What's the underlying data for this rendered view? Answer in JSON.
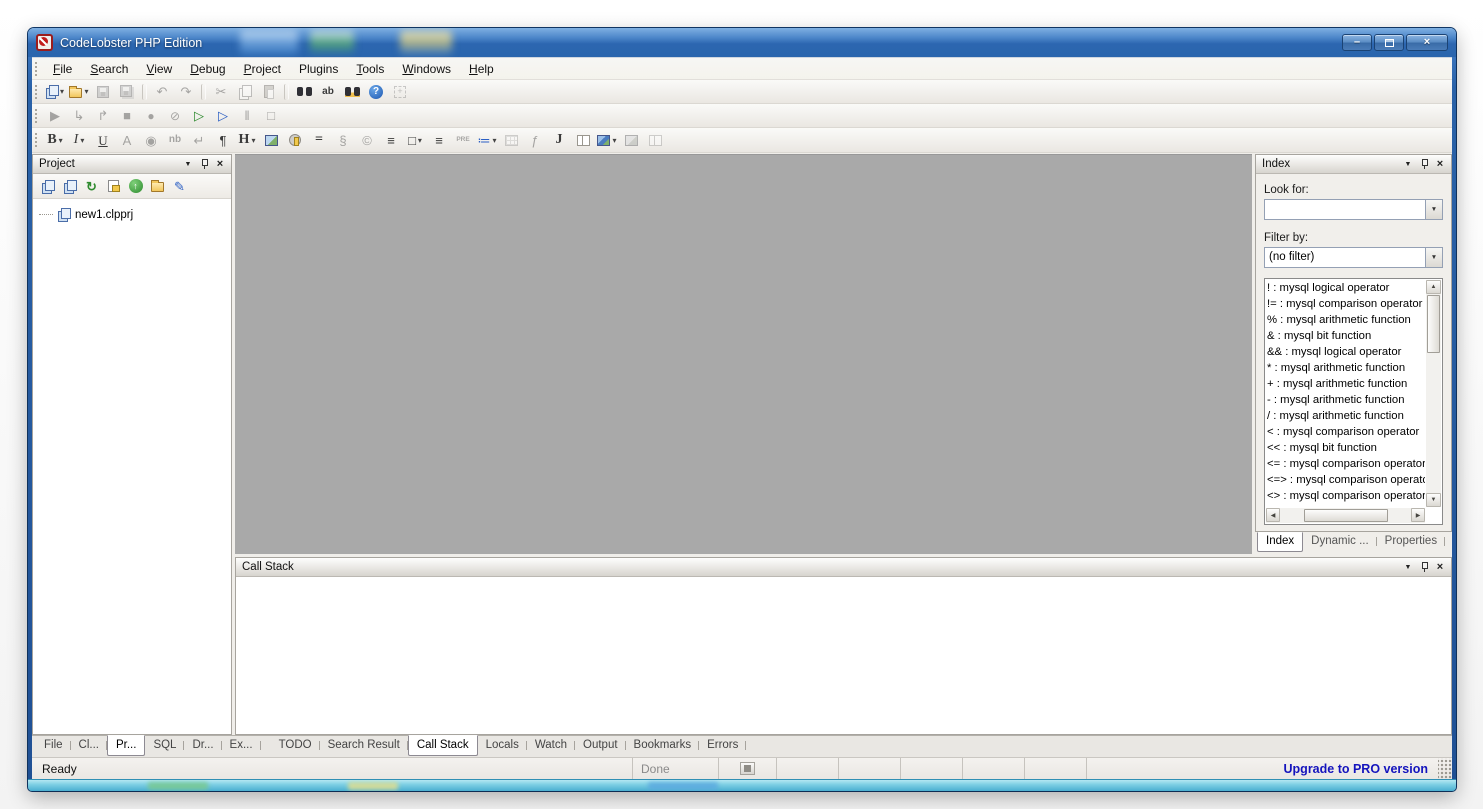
{
  "window": {
    "title": "CodeLobster PHP Edition",
    "controls": [
      {
        "name": "minimize-button",
        "glyph": "–",
        "cls": "wc-min"
      },
      {
        "name": "maximize-button",
        "glyph": "",
        "cls": "wc-max box-glyph"
      },
      {
        "name": "close-button",
        "glyph": "×",
        "cls": "wc-close"
      }
    ]
  },
  "icons": {
    "dropdown": "▼",
    "close": "×",
    "combo_arrow": "▼",
    "scroll_up": "▲",
    "scroll_down": "▼",
    "scroll_left": "◀",
    "scroll_right": "▶"
  },
  "menu": {
    "items": [
      {
        "label": "File"
      },
      {
        "label": "Search"
      },
      {
        "label": "View"
      },
      {
        "label": "Debug"
      },
      {
        "label": "Project"
      },
      {
        "label": "Plugins",
        "cls": "no-u"
      },
      {
        "label": "Tools"
      },
      {
        "label": "Windows"
      },
      {
        "label": "Help"
      }
    ]
  },
  "toolbars": {
    "standard": [
      {
        "name": "new-file-button",
        "cls": "s-pages",
        "dd": true
      },
      {
        "name": "open-file-button",
        "cls": "s-folder",
        "dd": true
      },
      {
        "name": "save-button",
        "cls": "s-disk",
        "disabled": true
      },
      {
        "name": "save-all-button",
        "cls": "s-disk multi",
        "disabled": true
      },
      {
        "name": "toolbar-separator",
        "cls": "sep"
      },
      {
        "name": "undo-button",
        "glyph": "↶",
        "cls": "glyph",
        "disabled": true
      },
      {
        "name": "redo-button",
        "glyph": "↷",
        "cls": "glyph",
        "disabled": true
      },
      {
        "name": "toolbar-separator",
        "cls": "sep"
      },
      {
        "name": "cut-button",
        "glyph": "✂",
        "cls": "glyph",
        "disabled": true
      },
      {
        "name": "copy-button",
        "cls": "s-copy",
        "disabled": true
      },
      {
        "name": "paste-button",
        "cls": "s-paste",
        "disabled": true
      },
      {
        "name": "toolbar-separator",
        "cls": "sep"
      },
      {
        "name": "find-button",
        "cls": "s-binoc"
      },
      {
        "name": "replace-button",
        "glyph": "ab",
        "cls": "glyph sm"
      },
      {
        "name": "find-in-files-button",
        "cls": "s-binoc gold"
      },
      {
        "name": "help-button",
        "cls": "s-help"
      },
      {
        "name": "fullscreen-button",
        "cls": "s-expand",
        "disabled": true
      }
    ],
    "debug": [
      {
        "name": "run-button",
        "glyph": "▶",
        "cls": "glyph",
        "disabled": true
      },
      {
        "name": "step-into-button",
        "glyph": "↳",
        "cls": "glyph",
        "disabled": true
      },
      {
        "name": "step-over-button",
        "glyph": "↱",
        "cls": "glyph",
        "disabled": true
      },
      {
        "name": "stop-debug-button",
        "glyph": "■",
        "cls": "glyph",
        "disabled": true
      },
      {
        "name": "breakpoint-button",
        "glyph": "●",
        "cls": "glyph big",
        "disabled": true
      },
      {
        "name": "clear-breakpoints-button",
        "glyph": "⊘",
        "cls": "glyph big",
        "disabled": true
      },
      {
        "name": "run-local-button",
        "glyph": "▷",
        "cls": "glyph c-green"
      },
      {
        "name": "run-in-browser-button",
        "glyph": "▷",
        "cls": "glyph c-blue"
      },
      {
        "name": "pause-button",
        "glyph": "‖",
        "cls": "glyph",
        "disabled": true
      },
      {
        "name": "stop-button",
        "glyph": "□",
        "cls": "glyph",
        "disabled": true
      }
    ],
    "format": [
      {
        "name": "bold-button",
        "glyph": "B",
        "cls": "glyph serif-b",
        "dd": true
      },
      {
        "name": "italic-button",
        "glyph": "I",
        "cls": "glyph serif-i",
        "dd": true
      },
      {
        "name": "underline-button",
        "glyph": "U",
        "cls": "glyph serif-u"
      },
      {
        "name": "font-button",
        "glyph": "A",
        "cls": "glyph",
        "disabled": true
      },
      {
        "name": "globe-button",
        "glyph": "◉",
        "cls": "glyph",
        "disabled": true
      },
      {
        "name": "nbsp-button",
        "glyph": "nb",
        "cls": "glyph sm",
        "disabled": true
      },
      {
        "name": "line-break-button",
        "glyph": "↵",
        "cls": "glyph",
        "disabled": true
      },
      {
        "name": "paragraph-button",
        "glyph": "¶",
        "cls": "glyph"
      },
      {
        "name": "heading-button",
        "glyph": "H",
        "cls": "glyph serif-b",
        "dd": true
      },
      {
        "name": "insert-image-button",
        "cls": "s-img"
      },
      {
        "name": "anchor-button",
        "cls": "s-anchor"
      },
      {
        "name": "horizontal-rule-button",
        "glyph": "=",
        "cls": "glyph serif-b"
      },
      {
        "name": "special-char-button",
        "glyph": "§",
        "cls": "glyph",
        "disabled": true
      },
      {
        "name": "copyright-button",
        "glyph": "©",
        "cls": "glyph",
        "disabled": true
      },
      {
        "name": "justify-button",
        "glyph": "≡",
        "cls": "glyph"
      },
      {
        "name": "div-button",
        "glyph": "□",
        "cls": "glyph",
        "dd": true
      },
      {
        "name": "align-top-button",
        "glyph": "≡",
        "cls": "glyph"
      },
      {
        "name": "pre-button",
        "glyph": "PRE",
        "cls": "glyph xs",
        "disabled": true
      },
      {
        "name": "list-button",
        "glyph": "≔",
        "cls": "glyph c-blue",
        "dd": true
      },
      {
        "name": "table-button",
        "cls": "s-table",
        "disabled": true
      },
      {
        "name": "form-button",
        "glyph": "ƒ",
        "cls": "glyph",
        "disabled": true
      },
      {
        "name": "script-button",
        "glyph": "J",
        "cls": "glyph serif-b"
      },
      {
        "name": "frame-button",
        "cls": "s-frame"
      },
      {
        "name": "object-button",
        "cls": "s-img obj",
        "dd": true
      },
      {
        "name": "image-map-button",
        "cls": "s-img",
        "disabled": true
      },
      {
        "name": "layout-button",
        "cls": "s-frame",
        "disabled": true
      }
    ]
  },
  "project_panel": {
    "title": "Project",
    "toolbar": [
      {
        "name": "add-file-button",
        "cls": "s-pages"
      },
      {
        "name": "add-folder-button",
        "cls": "s-pages"
      },
      {
        "name": "refresh-button",
        "glyph": "↻",
        "cls": "glyph c-green bold"
      },
      {
        "name": "properties-button",
        "cls": "s-prop"
      },
      {
        "name": "upload-button",
        "cls": "s-up"
      },
      {
        "name": "explore-button",
        "cls": "s-folder"
      },
      {
        "name": "settings-button",
        "glyph": "✎",
        "cls": "glyph c-blue"
      }
    ],
    "tree_item": "new1.clpprj"
  },
  "index_panel": {
    "title": "Index",
    "look_for_label": "Look for:",
    "look_for_value": "",
    "filter_by_label": "Filter by:",
    "filter_value": "(no filter)",
    "items": [
      "! : mysql logical operator",
      "!= : mysql comparison operator",
      "% : mysql arithmetic function",
      "& : mysql bit function",
      "&& : mysql logical operator",
      "* : mysql arithmetic function",
      "+ : mysql arithmetic function",
      "- : mysql arithmetic function",
      "/ : mysql arithmetic function",
      "< : mysql comparison operator",
      "<< : mysql bit function",
      "<= : mysql comparison operator",
      "<=> : mysql comparison operator",
      "<> : mysql comparison operator"
    ],
    "tabs": [
      {
        "label": "Index",
        "active": true
      },
      {
        "label": "Dynamic ..."
      },
      {
        "label": "Properties"
      }
    ]
  },
  "callstack_panel": {
    "title": "Call Stack"
  },
  "bottom_tabs": {
    "left": [
      {
        "label": "File"
      },
      {
        "label": "Cl..."
      },
      {
        "label": "Pr...",
        "active": true
      },
      {
        "label": "SQL"
      },
      {
        "label": "Dr..."
      },
      {
        "label": "Ex..."
      }
    ],
    "right": [
      {
        "label": "TODO"
      },
      {
        "label": "Search Result"
      },
      {
        "label": "Call Stack",
        "active": true
      },
      {
        "label": "Locals"
      },
      {
        "label": "Watch"
      },
      {
        "label": "Output"
      },
      {
        "label": "Bookmarks"
      },
      {
        "label": "Errors"
      }
    ]
  },
  "status_bar": {
    "ready": "Ready",
    "done": "Done",
    "upgrade": "Upgrade to PRO version"
  },
  "colors": {
    "titlebar_blue": "#2a65ad",
    "editor_gray": "#a9a9a9",
    "upgrade_blue": "#1414bd",
    "frame_cyan": "#7fd0e4"
  }
}
